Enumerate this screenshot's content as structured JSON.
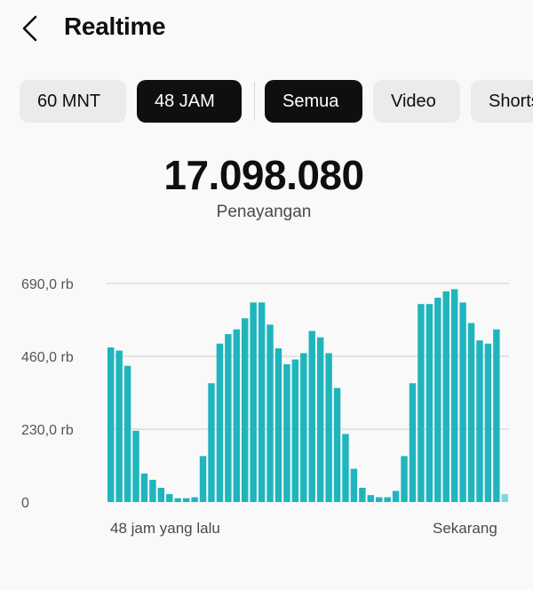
{
  "header": {
    "title": "Realtime",
    "back_icon": "chevron-left-icon"
  },
  "chips": [
    {
      "label": "60 MNT",
      "selected": false
    },
    {
      "label": "48 JAM",
      "selected": true
    },
    {
      "label": "Semua",
      "selected": true
    },
    {
      "label": "Video",
      "selected": false
    },
    {
      "label": "Shorts",
      "selected": false
    }
  ],
  "summary": {
    "value": "17.098.080",
    "label": "Penayangan"
  },
  "chart_data": {
    "type": "bar",
    "bar_color": "#1fb5bd",
    "highlight_color": "#7ed8dc",
    "yticks": [
      {
        "value": 690000,
        "label": "690,0 rb"
      },
      {
        "value": 460000,
        "label": "460,0 rb"
      },
      {
        "value": 230000,
        "label": "230,0 rb"
      },
      {
        "value": 0,
        "label": "0"
      }
    ],
    "ylim": [
      0,
      700000
    ],
    "x_start_label": "48 jam yang lalu",
    "x_end_label": "Sekarang",
    "values": [
      488000,
      478000,
      430000,
      225000,
      90000,
      70000,
      45000,
      25000,
      12000,
      12000,
      15000,
      145000,
      375000,
      500000,
      530000,
      545000,
      580000,
      630000,
      630000,
      560000,
      485000,
      435000,
      450000,
      470000,
      540000,
      520000,
      470000,
      360000,
      215000,
      105000,
      45000,
      22000,
      15000,
      15000,
      35000,
      145000,
      375000,
      625000,
      625000,
      645000,
      665000,
      672000,
      630000,
      565000,
      510000,
      500000,
      545000,
      25000
    ]
  }
}
